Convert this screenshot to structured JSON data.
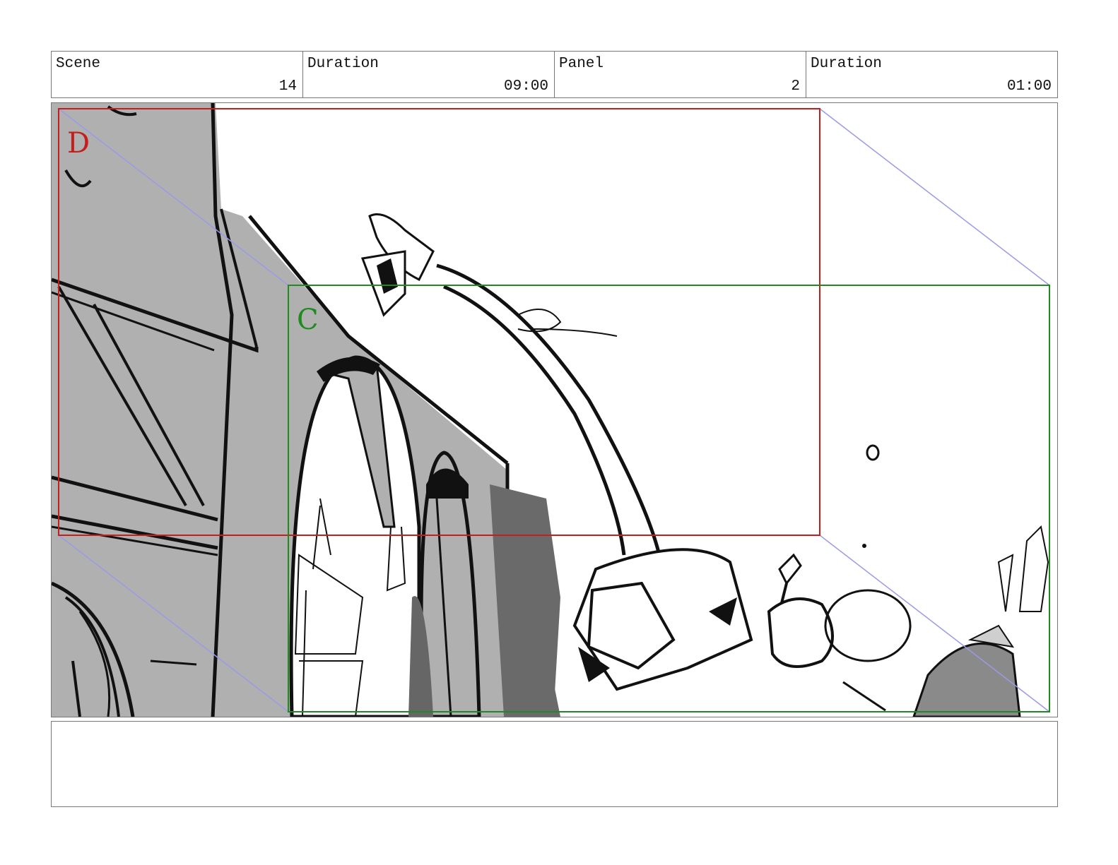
{
  "header": {
    "scene_label": "Scene",
    "scene_value": "14",
    "scene_duration_label": "Duration",
    "scene_duration_value": "09:00",
    "panel_label": "Panel",
    "panel_value": "2",
    "panel_duration_label": "Duration",
    "panel_duration_value": "01:00"
  },
  "camera": {
    "frame_d_label": "D",
    "frame_c_label": "C",
    "frame_d_color": "#c41e1e",
    "frame_c_color": "#1f8a1f",
    "guide_color": "#9a9ae8"
  },
  "notes": {
    "text": ""
  }
}
